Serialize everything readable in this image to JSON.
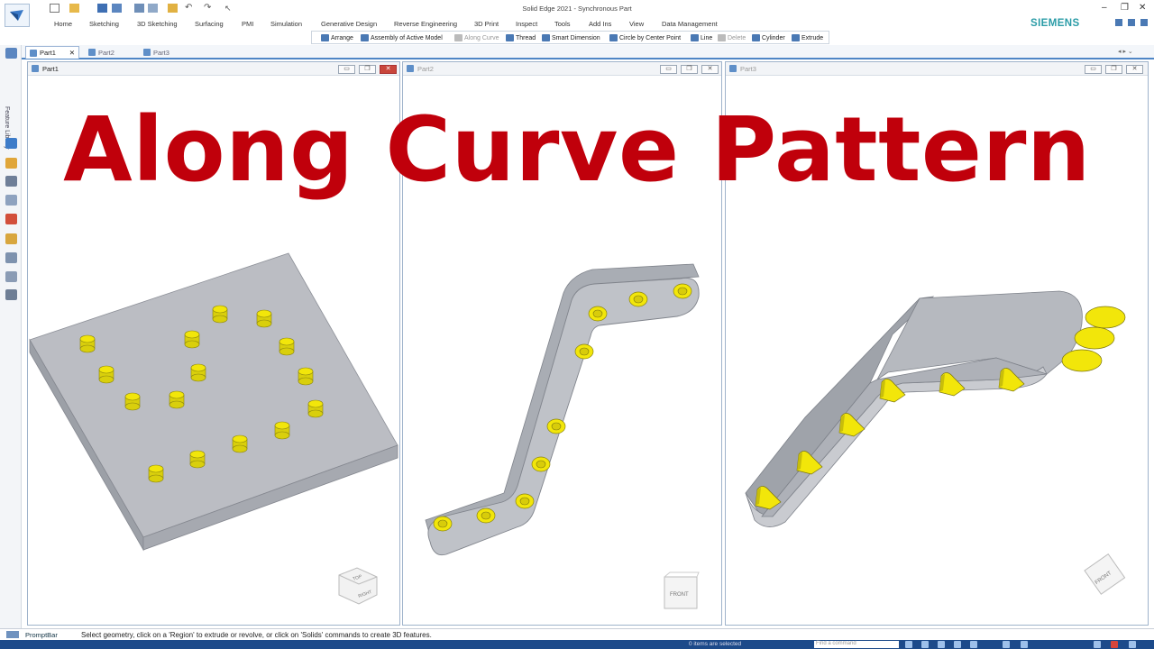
{
  "app": {
    "title": "Solid Edge 2021 - Synchronous Part",
    "brand": "SIEMENS"
  },
  "menu": [
    "Home",
    "Sketching",
    "3D Sketching",
    "Surfacing",
    "PMI",
    "Simulation",
    "Generative Design",
    "Reverse Engineering",
    "3D Print",
    "Inspect",
    "Tools",
    "Add Ins",
    "View",
    "Data Management"
  ],
  "commands": [
    {
      "label": "Arrange",
      "enabled": true
    },
    {
      "label": "Assembly of Active Model",
      "enabled": true
    },
    {
      "label": "Along Curve",
      "enabled": false
    },
    {
      "label": "Thread",
      "enabled": true
    },
    {
      "label": "Smart Dimension",
      "enabled": true
    },
    {
      "label": "Circle by Center Point",
      "enabled": true
    },
    {
      "label": "Line",
      "enabled": true
    },
    {
      "label": "Delete",
      "enabled": false
    },
    {
      "label": "Cylinder",
      "enabled": true
    },
    {
      "label": "Extrude",
      "enabled": true
    }
  ],
  "tabs": [
    {
      "label": "Part1",
      "active": true,
      "closable": true
    },
    {
      "label": "Part2",
      "active": false,
      "closable": false
    },
    {
      "label": "Part3",
      "active": false,
      "closable": false
    }
  ],
  "sidebar": {
    "feature_library_label": "Feature Library"
  },
  "panes": [
    {
      "title": "Part1",
      "active": true,
      "view_cube": "TOP/RIGHT"
    },
    {
      "title": "Part2",
      "active": false,
      "view_cube": "FRONT"
    },
    {
      "title": "Part3",
      "active": false,
      "view_cube": "FRONT"
    }
  ],
  "overlay_title": "Along Curve Pattern",
  "promptbar": {
    "label": "PromptBar",
    "message": "Select geometry, click on a 'Region' to extrude or revolve, or click on 'Solids' commands to create 3D features."
  },
  "status": {
    "selection": "0 items are selected",
    "find_placeholder": "Find a command"
  },
  "colors": {
    "title_red": "#c0000b",
    "part_gray": "#b9bcc2",
    "pin_yellow": "#f2e60a",
    "accent_blue": "#1c4a8a",
    "brand_teal": "#2b9ca7"
  }
}
